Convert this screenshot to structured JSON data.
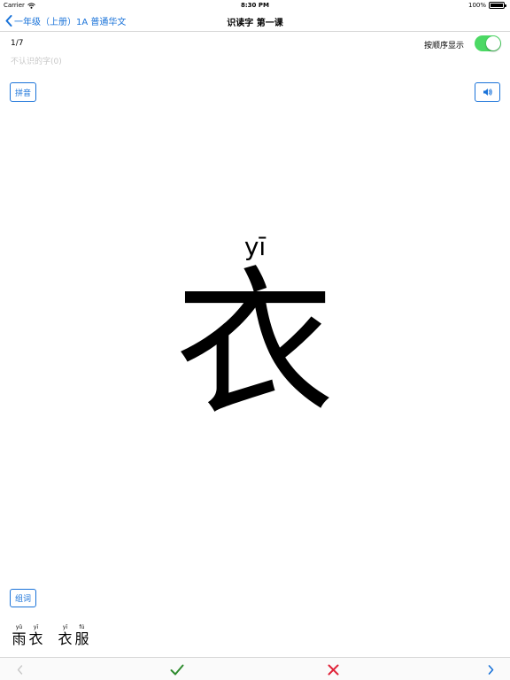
{
  "status_bar": {
    "carrier": "Carrier",
    "time": "8:30 PM",
    "battery": "100%"
  },
  "nav": {
    "back_label": "一年级（上册）1A 普通华文",
    "title": "识读字 第一课"
  },
  "progress": "1/7",
  "unknown_label": "不认识的字(0)",
  "order_toggle": {
    "label": "按顺序显示",
    "on": true
  },
  "pinyin_button": "拼音",
  "words_button": "组词",
  "character": {
    "pinyin": "yī",
    "hanzi": "衣"
  },
  "words": [
    {
      "syllables": [
        {
          "pinyin": "yǔ",
          "hanzi": "雨"
        },
        {
          "pinyin": "yī",
          "hanzi": "衣"
        }
      ]
    },
    {
      "syllables": [
        {
          "pinyin": "yī",
          "hanzi": "衣"
        },
        {
          "pinyin": "fú",
          "hanzi": "服"
        }
      ]
    }
  ],
  "icons": {
    "back": "chevron-left-icon",
    "speaker": "speaker-icon",
    "prev": "chevron-left-icon",
    "known": "checkmark-icon",
    "unknown": "cross-icon",
    "next": "chevron-right-icon"
  },
  "colors": {
    "accent": "#1a73d9",
    "toggle_on": "#4cd964",
    "check": "#2e8b2e",
    "cross": "#e0243a",
    "disabled": "#c8c8c8"
  }
}
